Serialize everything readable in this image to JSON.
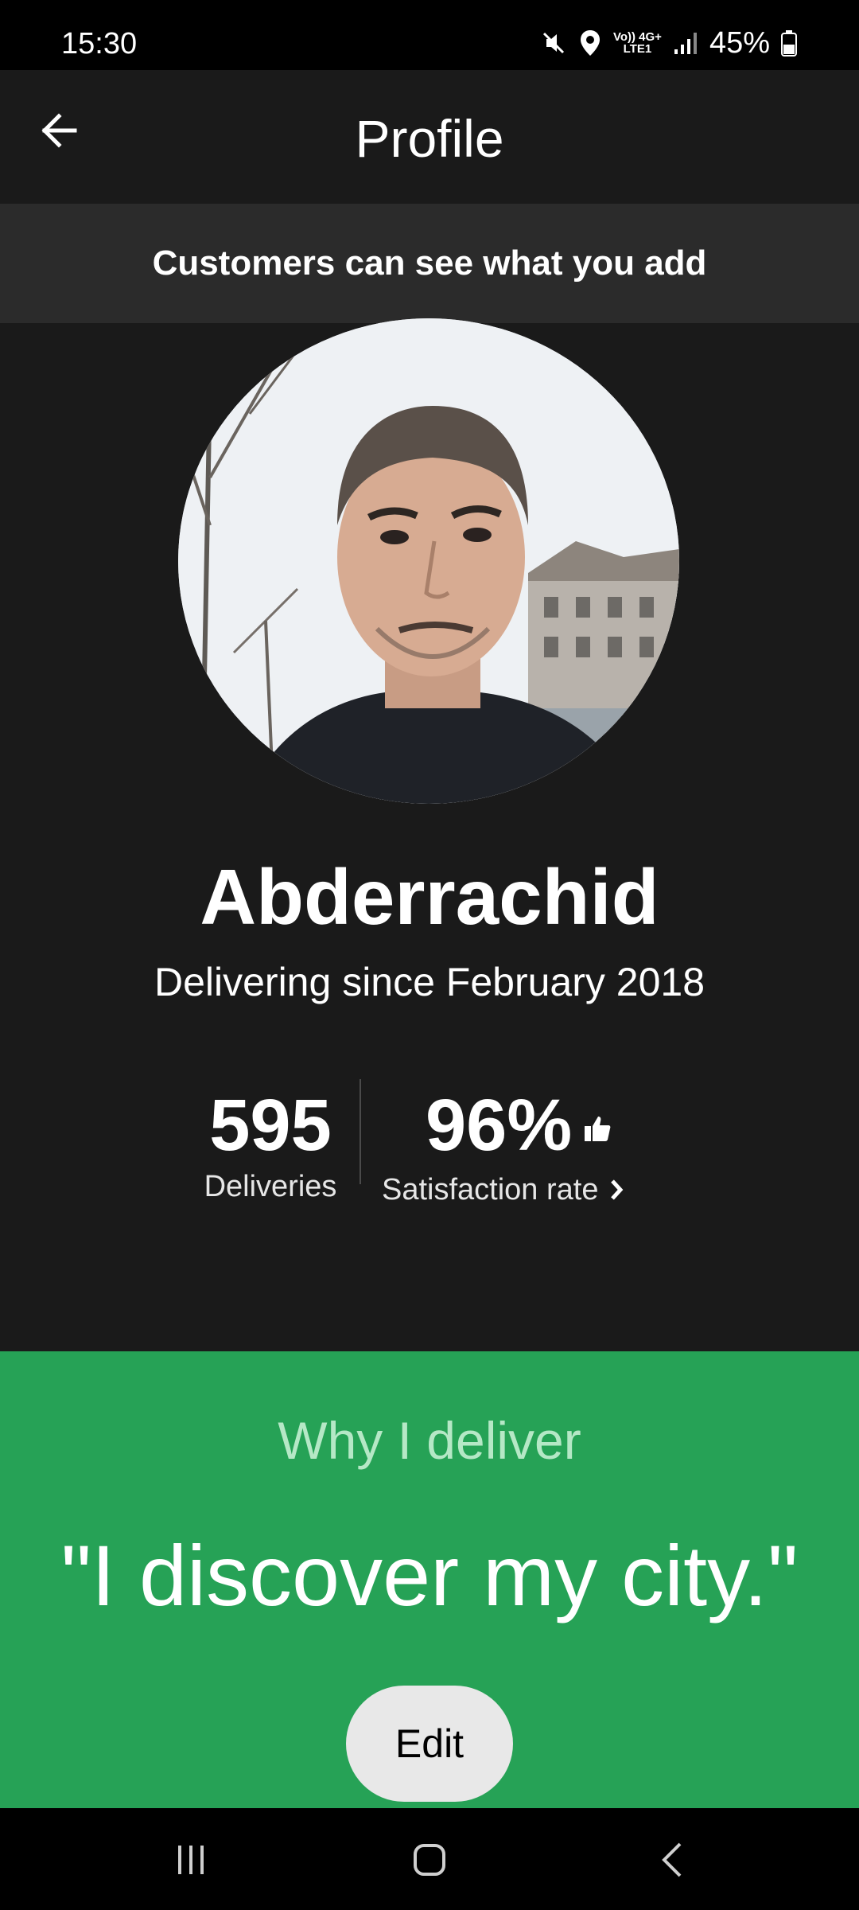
{
  "status_bar": {
    "time": "15:30",
    "network_top": "Vo)) 4G+",
    "network_bottom": "LTE1",
    "battery": "45%",
    "icons": [
      "mute-icon",
      "location-icon",
      "signal-icon",
      "battery-icon"
    ]
  },
  "app_bar": {
    "title": "Profile",
    "back_icon": "arrow-left-icon"
  },
  "banner": {
    "text": "Customers can see what you add"
  },
  "profile": {
    "name": "Abderrachid",
    "delivering_since": "Delivering since February 2018"
  },
  "stats": {
    "deliveries_value": "595",
    "deliveries_label": "Deliveries",
    "satisfaction_value": "96%",
    "satisfaction_label": "Satisfaction rate"
  },
  "why_section": {
    "title": "Why I deliver",
    "quote": "\"I discover my city.\"",
    "edit_label": "Edit"
  },
  "nav_bar": {
    "icons": [
      "recent-apps-icon",
      "home-icon",
      "back-icon"
    ]
  },
  "colors": {
    "background": "#1a1a1a",
    "banner": "#2b2b2b",
    "green": "#26a256",
    "why_title": "#b5e8c6",
    "edit_button": "#e8e8e8"
  }
}
